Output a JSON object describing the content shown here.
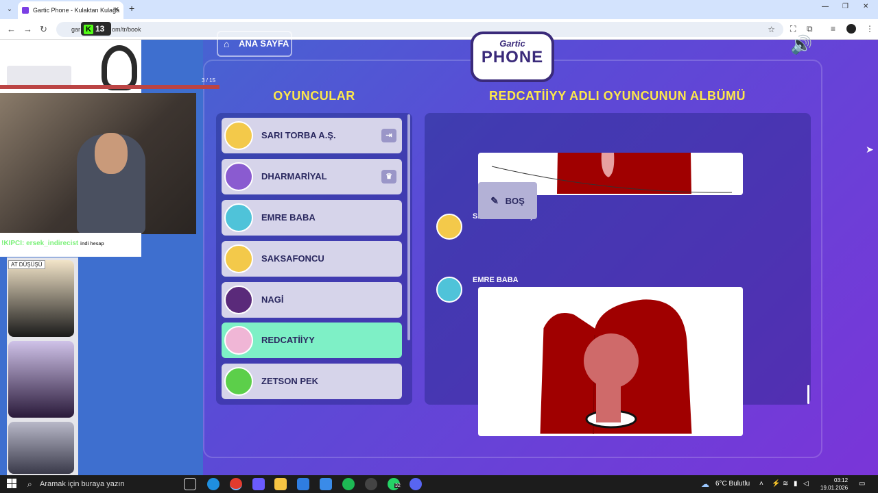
{
  "browser": {
    "tab_title": "Gartic Phone - Kulaktan Kulağa",
    "new_tab": "+",
    "url_prefix": "gar",
    "url_suffix": "om/tr/book",
    "badge": {
      "k": "K",
      "count": "13"
    }
  },
  "game": {
    "home_button": "ANA SAYFA",
    "logo_top": "Gartic",
    "logo_bottom": "PHONE",
    "players_heading": "OYUNCULAR",
    "album_heading": "REDCATİİYY ADLI OYUNCUNUN ALBÜMÜ",
    "players": [
      {
        "name": "SARI TORBA A.Ş.",
        "badge": "⇥",
        "active": false,
        "color": "#f3c94a"
      },
      {
        "name": "DHARMARİYAL",
        "badge": "♛",
        "active": false,
        "color": "#8a5bd0"
      },
      {
        "name": "EMRE BABA",
        "badge": "",
        "active": false,
        "color": "#4fc3d9"
      },
      {
        "name": "SAKSAFONCU",
        "badge": "",
        "active": false,
        "color": "#f3c94a"
      },
      {
        "name": "NAGİ",
        "badge": "",
        "active": false,
        "color": "#5a2a7a"
      },
      {
        "name": "REDCATİİYY",
        "badge": "",
        "active": true,
        "color": "#f0b6d6"
      },
      {
        "name": "ZETSON PEK",
        "badge": "",
        "active": false,
        "color": "#5ccf4a"
      }
    ],
    "album": {
      "entry1_author": "SARI TORBA A.Ş.",
      "entry1_text": "BOŞ",
      "entry2_author": "EMRE BABA"
    }
  },
  "stream_overlay": {
    "progress_label": "3 / 15",
    "ad_text": "!KIPCI: ersek_indirecist",
    "ad_sub": "indi hesap",
    "phones_label": "AT DÜŞÜŞÜ"
  },
  "taskbar": {
    "search_placeholder": "Aramak için buraya yazın",
    "weather": "6°C Bulutlu",
    "time": "03:12",
    "date": "19.01.2026",
    "notif_count": "32"
  }
}
